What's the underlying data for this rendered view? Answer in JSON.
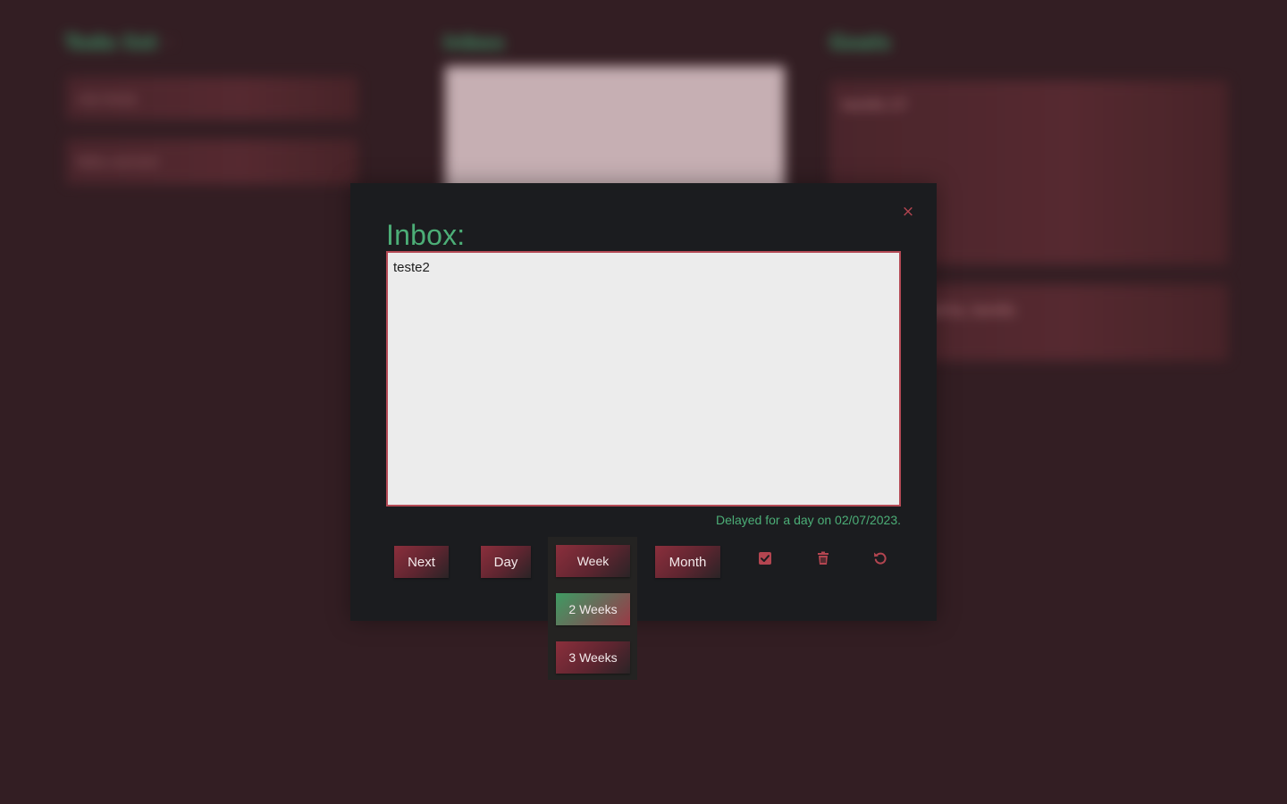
{
  "background": {
    "columns": [
      {
        "heading": "Todo list",
        "cards": [
          "cite fonte",
          "falta concluir"
        ]
      },
      {
        "heading": "Inbox",
        "cards": []
      },
      {
        "heading": "Goals",
        "cards": [
          "tarefa 17",
          "Ya ma vai mud-la, tarefa"
        ]
      }
    ]
  },
  "modal": {
    "title": "Inbox:",
    "close_label": "×",
    "note_text": "teste2",
    "delay_status": "Delayed for a day on 02/07/2023.",
    "buttons": {
      "next": "Next",
      "day": "Day",
      "week": "Week",
      "month": "Month"
    },
    "week_dropdown": {
      "options": [
        "2 Weeks",
        "3 Weeks"
      ],
      "highlighted": "2 Weeks"
    },
    "icons": {
      "done": "check-square-icon",
      "delete": "trash-icon",
      "undo": "undo-icon"
    }
  },
  "colors": {
    "accent_green": "#4cae77",
    "accent_red": "#b34550",
    "modal_bg": "#1b1c1f",
    "page_bg": "#331e23"
  }
}
